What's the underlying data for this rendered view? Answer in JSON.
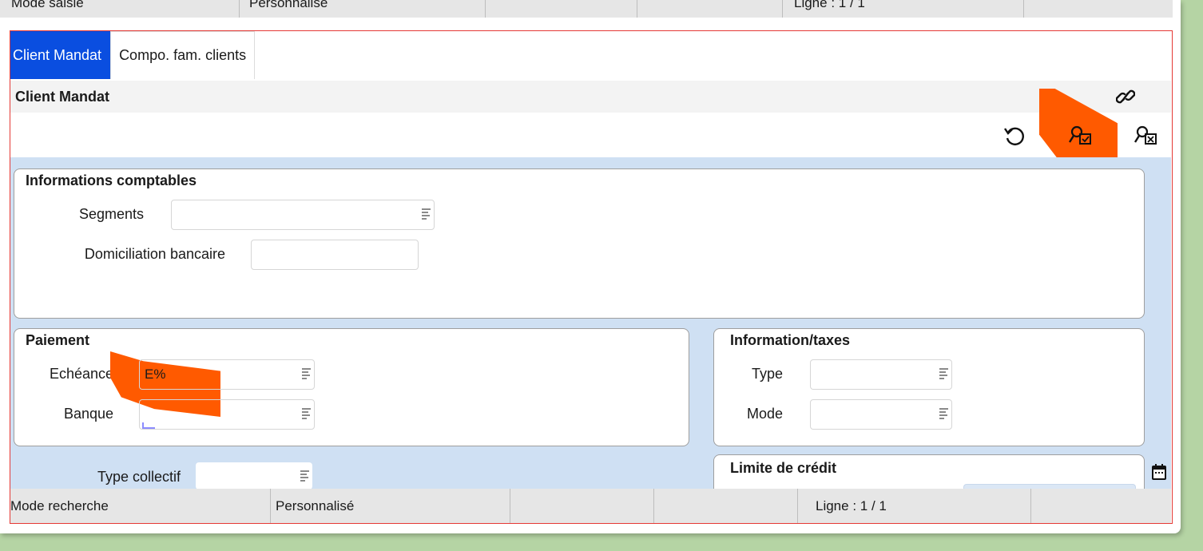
{
  "status_top": [
    "Mode saisie",
    "Personnalisé",
    "",
    "",
    "Ligne : 1 / 1",
    ""
  ],
  "tabs": [
    {
      "label": "Client Mandat",
      "active": true
    },
    {
      "label": "Compo. fam. clients",
      "active": false
    }
  ],
  "section_title": "Client Mandat",
  "toolbar_icons": [
    "link-icon",
    "refresh-icon",
    "search-validate-icon",
    "search-cancel-icon"
  ],
  "groups": {
    "informations_comptables": {
      "title": "Informations comptables",
      "segments_label": "Segments",
      "segments_value": "",
      "domiciliation_label": "Domiciliation bancaire",
      "domiciliation_value": ""
    },
    "paiement": {
      "title": "Paiement",
      "echeance_label": "Echéance",
      "echeance_value": "E%",
      "banque_label": "Banque",
      "banque_value": ""
    },
    "information_taxes": {
      "title": "Information/taxes",
      "type_label": "Type",
      "type_value": "",
      "mode_label": "Mode",
      "mode_value": ""
    },
    "limite_credit": {
      "title": "Limite de crédit"
    },
    "type_collectif_label": "Type collectif",
    "type_collectif_value": ""
  },
  "status_bottom": [
    "Mode recherche",
    "Personnalisé",
    "",
    "",
    "Ligne : 1 / 1",
    ""
  ],
  "colors": {
    "active_tab": "#0a4ee0",
    "frame": "#e53935",
    "form_bg": "#cfe0f3",
    "highlight": "#ff5a00"
  }
}
